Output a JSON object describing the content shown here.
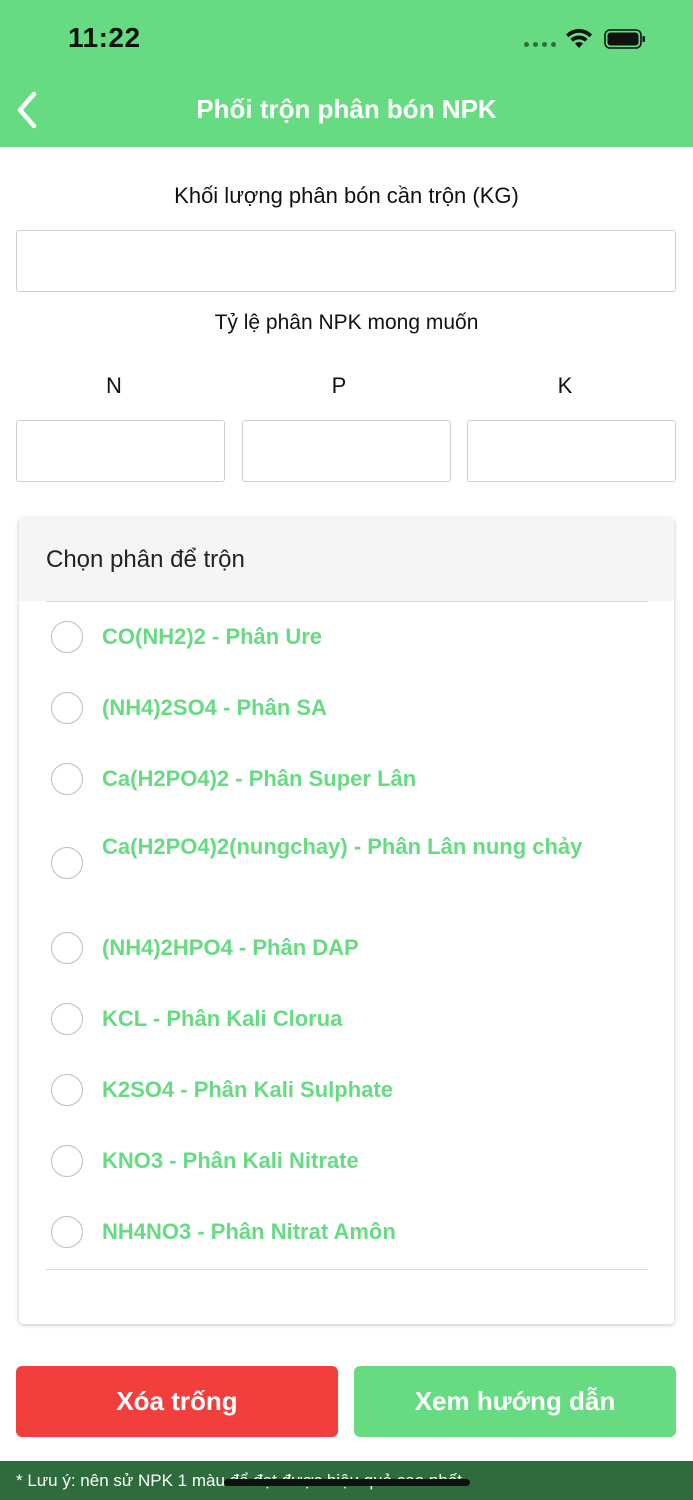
{
  "status_bar": {
    "time": "11:22"
  },
  "header": {
    "title": "Phối trộn phân bón NPK",
    "back_icon": "chevron-left-icon",
    "background_color": "#66db82"
  },
  "form": {
    "mass_label": "Khối lượng phân bón cần trộn (KG)",
    "mass_value": "",
    "ratio_label": "Tỷ lệ phân NPK mong muốn",
    "n_label": "N",
    "p_label": "P",
    "k_label": "K",
    "n_value": "",
    "p_value": "",
    "k_value": ""
  },
  "fertilizer_picker": {
    "title": "Chọn phân để trộn",
    "option_color": "#66db82",
    "options": [
      {
        "label": "CO(NH2)2 - Phân Ure",
        "selected": false
      },
      {
        "label": "(NH4)2SO4 - Phân SA",
        "selected": false
      },
      {
        "label": "Ca(H2PO4)2 - Phân Super Lân",
        "selected": false
      },
      {
        "label": "Ca(H2PO4)2(nungchay) - Phân Lân nung chảy",
        "selected": false
      },
      {
        "label": "(NH4)2HPO4 - Phân DAP",
        "selected": false
      },
      {
        "label": "KCL - Phân Kali Clorua",
        "selected": false
      },
      {
        "label": "K2SO4 - Phân Kali Sulphate",
        "selected": false
      },
      {
        "label": "KNO3 - Phân Kali Nitrate",
        "selected": false
      },
      {
        "label": "NH4NO3 - Phân Nitrat Amôn",
        "selected": false
      }
    ]
  },
  "actions": {
    "clear_label": "Xóa trống",
    "clear_color": "#f33e3e",
    "guide_label": "Xem hướng dẫn",
    "guide_color": "#66db82"
  },
  "footer": {
    "note": "* Lưu ý: nên sử NPK 1 màu để đạt được hiệu quả cao nhất.",
    "background_color": "#2e6b3d"
  }
}
